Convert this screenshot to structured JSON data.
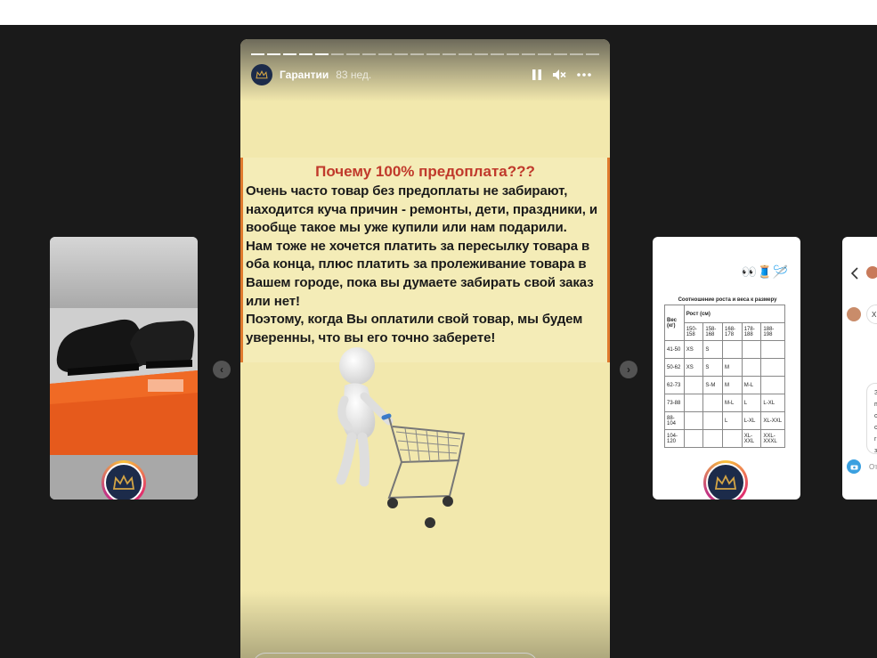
{
  "story": {
    "username": "Гарантии",
    "age": "83 нед.",
    "segments_total": 22,
    "segments_done": 5,
    "title": "Почему 100% предоплата???",
    "lines": [
      "Очень часто товар без предоплаты не забирают,",
      "находится куча причин - ремонты, дети, праздники, и",
      "вообще такое мы уже купили или нам подарили.",
      "Нам тоже не хочется платить за пересылку товара в",
      "оба конца, плюс платить за пролеживание товара в",
      "Вашем городе, пока вы думаете забирать свой заказ",
      "или нет!",
      "Поэтому, когда Вы оплатили свой товар, мы будем",
      "уверенны, что вы его точно заберете!"
    ],
    "icons": [
      "pause-icon",
      "mute-icon",
      "more-icon"
    ]
  },
  "right_card": {
    "emoji": "👀🧵🪡",
    "table_title": "Соотношение роста и веса к размеру",
    "header": [
      "Вес (кг)",
      "Рост (см)"
    ],
    "heights": [
      "150-158",
      "158-168",
      "168-178",
      "178-188",
      "188-198"
    ],
    "rows": [
      [
        "41-50",
        "XS",
        "S",
        "",
        "",
        ""
      ],
      [
        "50-62",
        "XS",
        "S",
        "M",
        "",
        ""
      ],
      [
        "62-73",
        "",
        "S-M",
        "M",
        "M-L",
        ""
      ],
      [
        "73-88",
        "",
        "",
        "M-L",
        "L",
        "L-XL"
      ],
      [
        "88-104",
        "",
        "",
        "L",
        "L-XL",
        "XL-XXL"
      ],
      [
        "104-120",
        "",
        "",
        "",
        "XL-XXL",
        "XXL-XXXL"
      ]
    ]
  },
  "far_card": {
    "back_icon": "chevron-left-icon",
    "reply_prefix": "От",
    "fragments": [
      "З",
      "п",
      "с",
      "с",
      "г",
      "з"
    ]
  },
  "colors": {
    "background": "#1a1a1a",
    "story_bg": "#f2e8ad",
    "title_red": "#c0392b",
    "frame_orange": "#e07a2d",
    "brand_navy": "#1c2b4a",
    "gold": "#d4a545"
  }
}
